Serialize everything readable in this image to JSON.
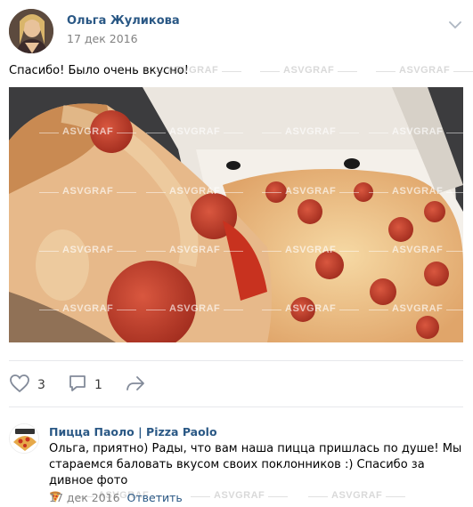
{
  "post": {
    "author": "Ольга Жуликова",
    "date": "17 дек 2016",
    "text": "Спасибо! Было очень вкусно!",
    "menu_icon": "chevron-down-icon"
  },
  "photo": {
    "watermark": "ASVGRAF"
  },
  "actions": {
    "likes": "3",
    "comments": "1",
    "like_icon": "heart-icon",
    "comment_icon": "comment-icon",
    "share_icon": "share-arrow-icon"
  },
  "comment": {
    "author": "Пицца Паоло | Pizza Paolo",
    "text": "Ольга, приятно) Рады, что вам наша пицца пришлась по душе! Мы стараемся баловать вкусом своих поклонников :) Спасибо за дивное фото",
    "emoji": "pizza-emoji",
    "date": "17 дек 2016",
    "reply_label": "Ответить"
  },
  "colors": {
    "link": "#2a5885",
    "muted": "#828282",
    "divider": "#e7e8ec"
  }
}
